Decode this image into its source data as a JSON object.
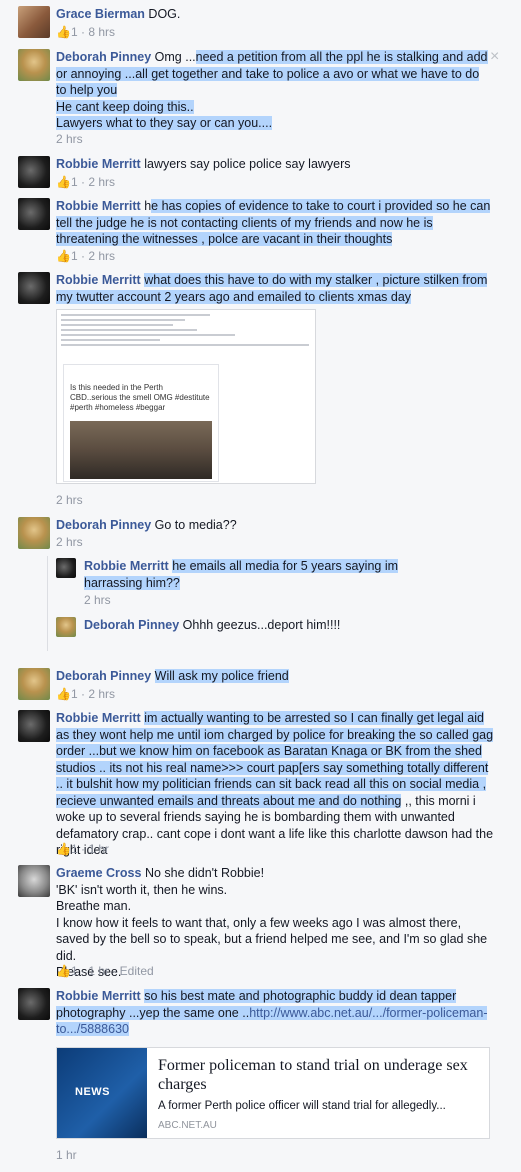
{
  "comments": {
    "grace": {
      "name": "Grace Bierman",
      "text": "DOG.",
      "likes": "1",
      "time": "8 hrs"
    },
    "deb1": {
      "name": "Deborah Pinney",
      "text_pre": "Omg ...",
      "text_hl": "need a petition from all the ppl he is stalking and add or annoying ...all get together and take to police a avo or what we have to do to help you",
      "line2": "He cant keep doing this..",
      "line3": "Lawyers what to they say or can you....",
      "time": "2 hrs",
      "close": "×"
    },
    "rob1": {
      "name": "Robbie Merritt",
      "text": "lawyers say police police say lawyers",
      "likes": "1",
      "time": "2 hrs"
    },
    "rob2": {
      "name": "Robbie Merritt",
      "text_pre": "h",
      "text_hl": "e has copies of evidence to take to court i provided so he can tell the judge he is not contacting clients of my friends and now he is threatening the witnesses , polce are vacant in their thoughts",
      "likes": "1",
      "time": "2 hrs"
    },
    "rob3": {
      "name": "Robbie Merritt",
      "text": "what does this have to do with my stalker , picture stilken from my twutter account 2 years ago and emailed to clients xmas day",
      "time": "2 hrs"
    },
    "attachment": {
      "tweet_text": "Is this needed in the Perth CBD..serious the smell OMG #destitute #perth #homeless #beggar"
    },
    "deb2": {
      "name": "Deborah Pinney",
      "text": "Go to media??",
      "time": "2 hrs"
    },
    "rob_reply": {
      "name": "Robbie Merritt",
      "text": "he emails all media for 5 years saying im harrassing him??",
      "time": "2 hrs"
    },
    "deb_reply": {
      "name": "Deborah Pinney",
      "text": "Ohhh geezus...deport him!!!!"
    },
    "deb3": {
      "name": "Deborah Pinney",
      "text": "Will ask my police friend",
      "likes": "1",
      "time": "2 hrs"
    },
    "rob4": {
      "name": "Robbie Merritt",
      "text": "im actually wanting to be arrested so I can finally get legal aid as they wont help me until iom charged by police for breaking the so called gag order ...but we know him on facebook as Baratan Knaga or BK from the shed studios .. its not his real name>>> court pap[ers say something totally different .. it bulshit how my politician friends can sit back read all this on social media , recieve unwanted emails and threats about me and do nothing",
      "text_tail": " ,, this morni i woke up to several friends saying he is bombarding them with unwanted defamatory crap.. cant cope i dont want a life like this charlotte dawson had the right idea",
      "likes": "1",
      "time": "1 hr"
    },
    "graeme": {
      "name": "Graeme Cross",
      "text": "No she didn't Robbie!",
      "line2": "'BK' isn't worth it, then he wins.",
      "line3": "Breathe man.",
      "line4": "I know how it feels to want that, only a few weeks ago I was almost there, saved by the bell so to speak, but a friend helped me see, and I'm so glad she did.",
      "line5": "Please see.",
      "likes": "1",
      "time": "1 hr",
      "edited": "Edited"
    },
    "rob5": {
      "name": "Robbie Merritt",
      "text": "so his best mate and photographic buddy id dean tapper photography ...yep the same one ..",
      "link": "http://www.abc.net.au/.../former-policeman-to.../5888630",
      "time": "1 hr"
    },
    "link_card": {
      "logo": "NEWS",
      "title": "Former policeman to stand trial on underage sex charges",
      "desc": "A former Perth police officer will stand trial for allegedly...",
      "host": "ABC.NET.AU"
    }
  }
}
